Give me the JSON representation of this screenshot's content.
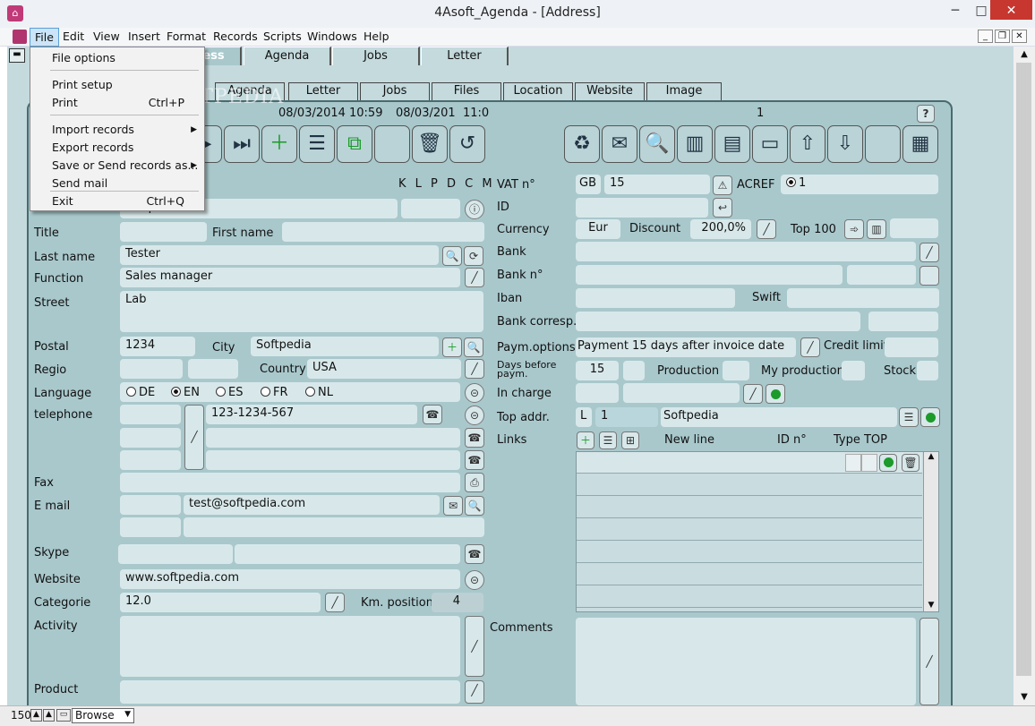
{
  "window": {
    "title": "4Asoft_Agenda - [Address]",
    "min": "─",
    "max": "□",
    "close": "✕"
  },
  "menubar": {
    "items": [
      "File",
      "Edit",
      "View",
      "Insert",
      "Format",
      "Records",
      "Scripts",
      "Windows",
      "Help"
    ]
  },
  "file_menu": {
    "file_options": "File options",
    "print_setup": "Print setup",
    "print": "Print",
    "print_shortcut": "Ctrl+P",
    "import": "Import records",
    "export": "Export records",
    "save_send": "Save or Send records as...",
    "send_mail": "Send mail",
    "exit": "Exit",
    "exit_shortcut": "Ctrl+Q"
  },
  "tabs_top": [
    "ess",
    "Agenda",
    "Jobs",
    "Letter"
  ],
  "tabs_second": [
    "Agenda",
    "Letter",
    "Jobs",
    "Files",
    "Location",
    "Website",
    "Image"
  ],
  "watermark": "SOFTPEDIA",
  "header": {
    "date1": "08/03/2014",
    "time1": "10:59",
    "date2": "08/03/201",
    "time2": "11:0",
    "record": "1",
    "help": "?"
  },
  "flags": "K L P D C M",
  "left": {
    "company_value": "Softpedia",
    "title_label": "Title",
    "firstname_label": "First name",
    "lastname_label": "Last name",
    "lastname_value": "Tester",
    "function_label": "Function",
    "function_value": "Sales manager",
    "street_label": "Street",
    "street_value": "Lab",
    "postal_label": "Postal",
    "postal_value": "1234",
    "city_label": "City",
    "city_value": "Softpedia",
    "regio_label": "Regio",
    "country_label": "Country",
    "country_value": "USA",
    "language_label": "Language",
    "languages": [
      "DE",
      "EN",
      "ES",
      "FR",
      "NL"
    ],
    "telephone_label": "telephone",
    "telephone_value": "123-1234-567",
    "fax_label": "Fax",
    "email_label": "E mail",
    "email_value": "test@softpedia.com",
    "skype_label": "Skype",
    "website_label": "Website",
    "website_value": "www.softpedia.com",
    "categorie_label": "Categorie",
    "categorie_value": "12.0",
    "km_label": "Km. position",
    "km_value": "4",
    "activity_label": "Activity",
    "product_label": "Product"
  },
  "right": {
    "vat_label": "VAT n°",
    "vat_country": "GB",
    "vat_value": "15",
    "acref_label": "ACREF",
    "acref_value": "1",
    "id_label": "ID",
    "currency_label": "Currency",
    "currency_value": "Eur",
    "discount_label": "Discount",
    "discount_value": "200,0%",
    "top100_label": "Top 100",
    "bank_label": "Bank",
    "bankno_label": "Bank n°",
    "iban_label": "Iban",
    "swift_label": "Swift",
    "bankcorr_label": "Bank corresp.",
    "paym_label": "Paym.options",
    "paym_value": "Payment 15 days after invoice date",
    "credit_label": "Credit limit",
    "days_label": "Days before paym.",
    "days_value": "15",
    "production_label": "Production",
    "myprod_label": "My production",
    "stock_label": "Stock",
    "incharge_label": "In charge",
    "topaddr_label": "Top addr.",
    "topaddr_l": "L",
    "topaddr_no": "1",
    "topaddr_value": "Softpedia",
    "links_label": "Links",
    "newline_label": "New line",
    "idno_label": "ID n°",
    "typetop_label": "Type TOP",
    "comments_label": "Comments"
  },
  "status": {
    "zoom": "150",
    "mode": "Browse"
  }
}
